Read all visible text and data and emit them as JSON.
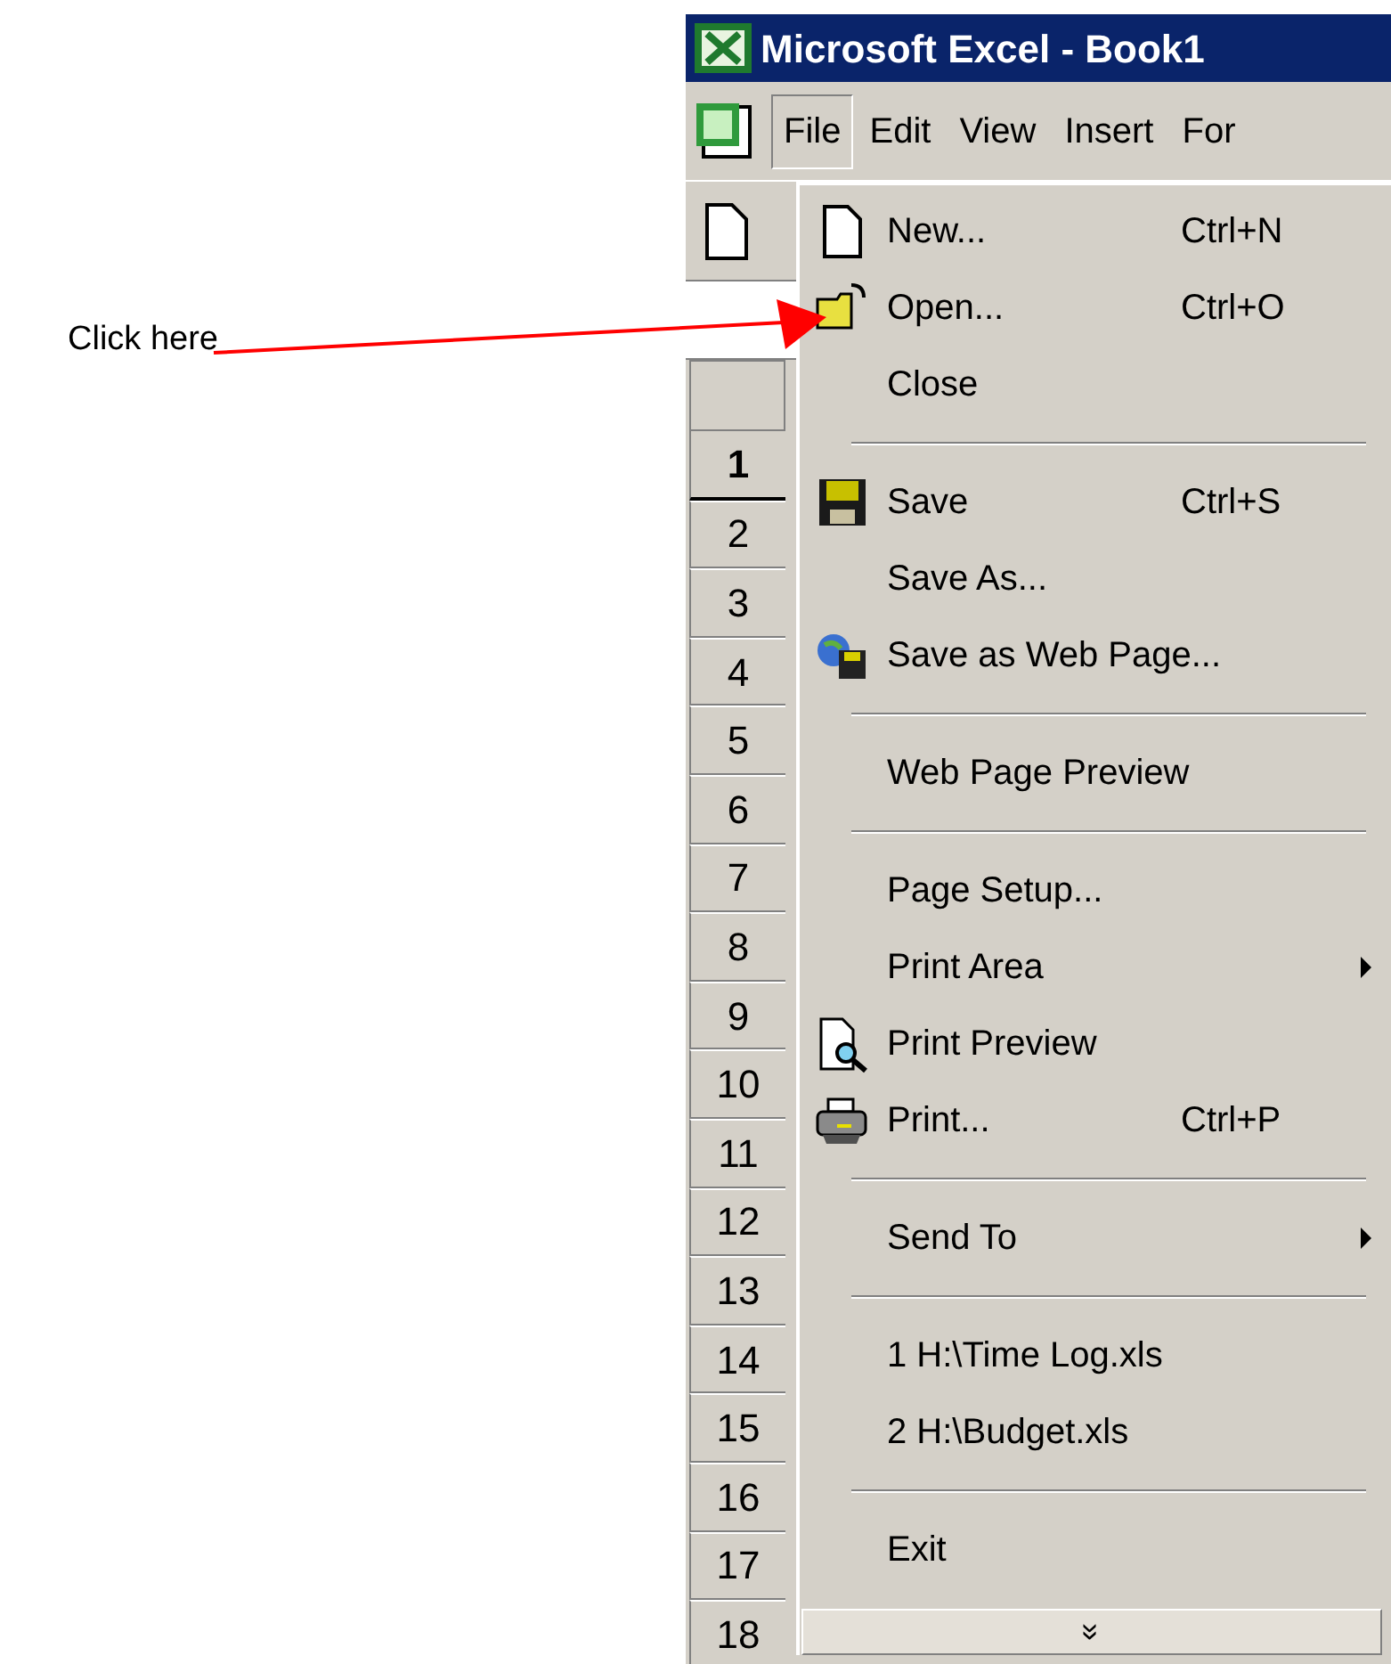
{
  "annotation": {
    "callout": "Click here"
  },
  "window": {
    "title": "Microsoft Excel - Book1"
  },
  "menu_bar": [
    {
      "label": "File",
      "selected": true
    },
    {
      "label": "Edit",
      "selected": false
    },
    {
      "label": "View",
      "selected": false
    },
    {
      "label": "Insert",
      "selected": false
    },
    {
      "label": "For",
      "selected": false
    }
  ],
  "row_headers": [
    {
      "label": "1",
      "selected": true
    },
    {
      "label": "2",
      "selected": false
    },
    {
      "label": "3",
      "selected": false
    },
    {
      "label": "4",
      "selected": false
    },
    {
      "label": "5",
      "selected": false
    },
    {
      "label": "6",
      "selected": false
    },
    {
      "label": "7",
      "selected": false
    },
    {
      "label": "8",
      "selected": false
    },
    {
      "label": "9",
      "selected": false
    },
    {
      "label": "10",
      "selected": false
    },
    {
      "label": "11",
      "selected": false
    },
    {
      "label": "12",
      "selected": false
    },
    {
      "label": "13",
      "selected": false
    },
    {
      "label": "14",
      "selected": false
    },
    {
      "label": "15",
      "selected": false
    },
    {
      "label": "16",
      "selected": false
    },
    {
      "label": "17",
      "selected": false
    },
    {
      "label": "18",
      "selected": false
    }
  ],
  "file_menu": {
    "items": [
      {
        "kind": "item",
        "label": "New...",
        "shortcut": "Ctrl+N",
        "submenu": false
      },
      {
        "kind": "item",
        "label": "Open...",
        "shortcut": "Ctrl+O",
        "submenu": false
      },
      {
        "kind": "item",
        "label": "Close",
        "submenu": false
      },
      {
        "kind": "separator"
      },
      {
        "kind": "item",
        "label": "Save",
        "shortcut": "Ctrl+S",
        "submenu": false
      },
      {
        "kind": "item",
        "label": "Save As...",
        "submenu": false
      },
      {
        "kind": "item",
        "label": "Save as Web Page...",
        "submenu": false
      },
      {
        "kind": "separator"
      },
      {
        "kind": "item",
        "label": "Web Page Preview",
        "submenu": false
      },
      {
        "kind": "separator"
      },
      {
        "kind": "item",
        "label": "Page Setup...",
        "submenu": false
      },
      {
        "kind": "item",
        "label": "Print Area",
        "submenu": true
      },
      {
        "kind": "item",
        "label": "Print Preview",
        "submenu": false
      },
      {
        "kind": "item",
        "label": "Print...",
        "shortcut": "Ctrl+P",
        "submenu": false
      },
      {
        "kind": "separator"
      },
      {
        "kind": "item",
        "label": "Send To",
        "submenu": true
      },
      {
        "kind": "separator"
      },
      {
        "kind": "item",
        "label": "1 H:\\Time Log.xls",
        "submenu": false
      },
      {
        "kind": "item",
        "label": "2 H:\\Budget.xls",
        "submenu": false
      },
      {
        "kind": "separator"
      },
      {
        "kind": "item",
        "label": "Exit",
        "submenu": false
      },
      {
        "kind": "more",
        "label": "»"
      }
    ]
  }
}
